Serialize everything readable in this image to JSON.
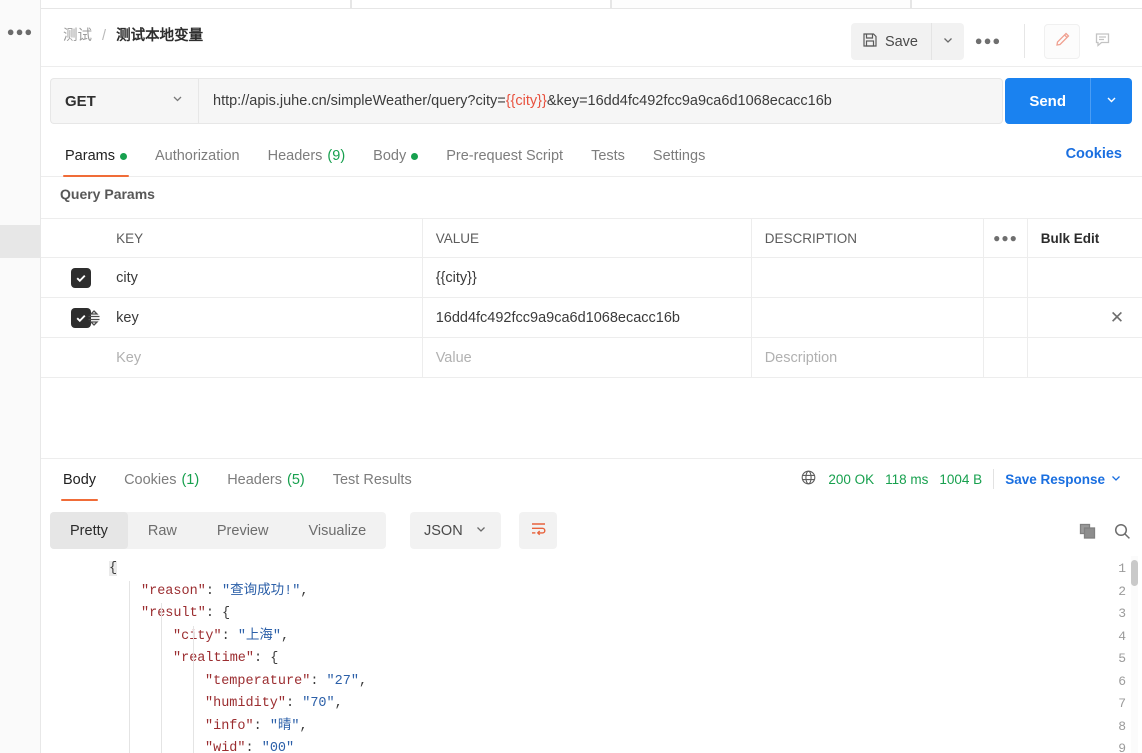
{
  "breadcrumb": {
    "collection": "测试",
    "separator": "/",
    "request": "测试本地变量"
  },
  "header": {
    "save_label": "Save",
    "save_icon": "floppy-disk-icon",
    "caret_icon": "chevron-down-icon",
    "more_icon": "ellipsis-icon",
    "edit_icon": "pencil-icon",
    "comment_icon": "comment-icon"
  },
  "request": {
    "method": "GET",
    "url_prefix": "http://apis.juhe.cn/simpleWeather/query?city=",
    "url_variable": "{{city}}",
    "url_suffix": "&key=16dd4fc492fcc9a9ca6d1068ecacc16b",
    "send_label": "Send"
  },
  "request_tabs": [
    {
      "label": "Params",
      "badge_dot": true,
      "active": true
    },
    {
      "label": "Authorization",
      "active": false
    },
    {
      "label": "Headers",
      "count": "(9)",
      "active": false
    },
    {
      "label": "Body",
      "badge_dot": true,
      "active": false
    },
    {
      "label": "Pre-request Script",
      "active": false
    },
    {
      "label": "Tests",
      "active": false
    },
    {
      "label": "Settings",
      "active": false
    }
  ],
  "cookies_link": "Cookies",
  "params": {
    "section_title": "Query Params",
    "columns": [
      "KEY",
      "VALUE",
      "DESCRIPTION"
    ],
    "more_icon": "ellipsis-icon",
    "bulk_edit_label": "Bulk Edit",
    "rows": [
      {
        "checked": true,
        "key": "city",
        "value": "{{city}}",
        "value_is_variable": true,
        "description": ""
      },
      {
        "checked": true,
        "key": "key",
        "value": "16dd4fc492fcc9a9ca6d1068ecacc16b",
        "value_is_variable": false,
        "description": ""
      }
    ],
    "placeholder_row": {
      "key": "Key",
      "value": "Value",
      "description": "Description"
    }
  },
  "response": {
    "tabs": [
      {
        "label": "Body",
        "active": true
      },
      {
        "label": "Cookies",
        "count": "(1)",
        "active": false
      },
      {
        "label": "Headers",
        "count": "(5)",
        "active": false
      },
      {
        "label": "Test Results",
        "active": false
      }
    ],
    "globe_icon": "globe-icon",
    "status": "200 OK",
    "time": "118 ms",
    "size": "1004 B",
    "save_response_label": "Save Response",
    "format_tabs": [
      {
        "label": "Pretty",
        "active": true
      },
      {
        "label": "Raw",
        "active": false
      },
      {
        "label": "Preview",
        "active": false
      },
      {
        "label": "Visualize",
        "active": false
      }
    ],
    "language": "JSON",
    "wrap_icon": "word-wrap-icon",
    "copy_icon": "copy-icon",
    "search_icon": "search-icon"
  },
  "json_body": {
    "lines": [
      {
        "n": "1",
        "indent": 0,
        "tokens": [
          {
            "t": "{",
            "c": "p"
          }
        ]
      },
      {
        "n": "2",
        "indent": 1,
        "tokens": [
          {
            "t": "\"reason\"",
            "c": "k"
          },
          {
            "t": ": ",
            "c": "p"
          },
          {
            "t": "\"查询成功!\"",
            "c": "s"
          },
          {
            "t": ",",
            "c": "p"
          }
        ]
      },
      {
        "n": "3",
        "indent": 1,
        "tokens": [
          {
            "t": "\"result\"",
            "c": "k"
          },
          {
            "t": ": {",
            "c": "p"
          }
        ]
      },
      {
        "n": "4",
        "indent": 2,
        "tokens": [
          {
            "t": "\"city\"",
            "c": "k"
          },
          {
            "t": ": ",
            "c": "p"
          },
          {
            "t": "\"上海\"",
            "c": "s"
          },
          {
            "t": ",",
            "c": "p"
          }
        ]
      },
      {
        "n": "5",
        "indent": 2,
        "tokens": [
          {
            "t": "\"realtime\"",
            "c": "k"
          },
          {
            "t": ": {",
            "c": "p"
          }
        ]
      },
      {
        "n": "6",
        "indent": 3,
        "tokens": [
          {
            "t": "\"temperature\"",
            "c": "k"
          },
          {
            "t": ": ",
            "c": "p"
          },
          {
            "t": "\"27\"",
            "c": "s"
          },
          {
            "t": ",",
            "c": "p"
          }
        ]
      },
      {
        "n": "7",
        "indent": 3,
        "tokens": [
          {
            "t": "\"humidity\"",
            "c": "k"
          },
          {
            "t": ": ",
            "c": "p"
          },
          {
            "t": "\"70\"",
            "c": "s"
          },
          {
            "t": ",",
            "c": "p"
          }
        ]
      },
      {
        "n": "8",
        "indent": 3,
        "tokens": [
          {
            "t": "\"info\"",
            "c": "k"
          },
          {
            "t": ": ",
            "c": "p"
          },
          {
            "t": "\"晴\"",
            "c": "s"
          },
          {
            "t": ",",
            "c": "p"
          }
        ]
      },
      {
        "n": "9",
        "indent": 3,
        "tokens": [
          {
            "t": "\"wid\"",
            "c": "k"
          },
          {
            "t": ": ",
            "c": "p"
          },
          {
            "t": "\"00\"",
            "c": "s"
          }
        ]
      }
    ]
  }
}
